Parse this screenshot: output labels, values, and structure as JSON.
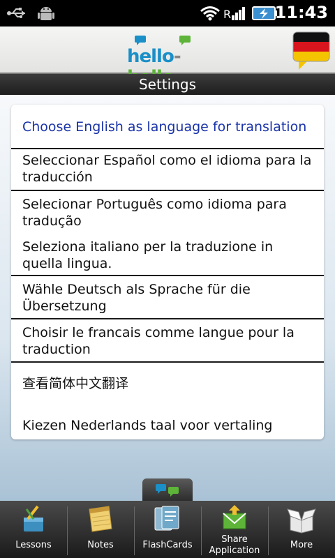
{
  "status_bar": {
    "time": "11:43",
    "icons": [
      "usb-icon",
      "android-icon",
      "wifi-icon",
      "signal-icon",
      "battery-charging-icon"
    ]
  },
  "header": {
    "logo": {
      "part1": "hello",
      "dash": "-",
      "part2": "hello"
    },
    "flag_icon": "german-flag-icon",
    "colors": {
      "logo_blue": "#1a8fc8",
      "logo_green": "#5db438"
    }
  },
  "title": "Settings",
  "options": [
    {
      "line1": "Choose English as language for translation",
      "line2": ""
    },
    {
      "line1": "Seleccionar Español como el idioma para la",
      "line2": "traducción"
    },
    {
      "line1": "Selecionar Português como idioma para",
      "line2": "tradução"
    },
    {
      "line1": "Seleziona italiano per la traduzione in",
      "line2": "quella lingua."
    },
    {
      "line1": "Wähle Deutsch als Sprache für die",
      "line2": "Übersetzung"
    },
    {
      "line1": "Choisir le francais comme langue pour la",
      "line2": "traduction"
    },
    {
      "line1": "查看简体中文翻译",
      "line2": ""
    },
    {
      "line1": "Kiezen Nederlands taal voor vertaling",
      "line2": ""
    }
  ],
  "nav": {
    "items": [
      {
        "label": "Lessons",
        "icon": "lessons-icon"
      },
      {
        "label": "Notes",
        "icon": "notes-icon"
      },
      {
        "label": "FlashCards",
        "icon": "flashcards-icon"
      },
      {
        "label_line1": "Share",
        "label_line2": "Application",
        "icon": "share-icon"
      },
      {
        "label": "More",
        "icon": "more-box-icon"
      }
    ]
  }
}
